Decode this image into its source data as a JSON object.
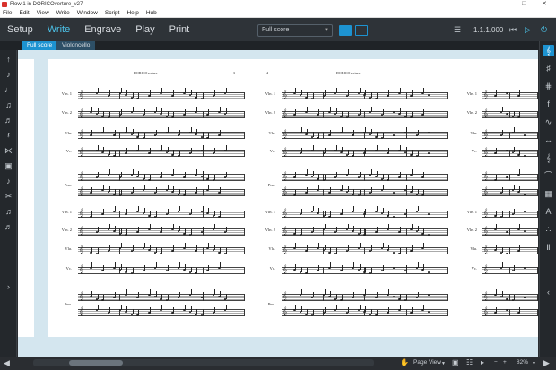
{
  "window": {
    "title": "Flow 1 in DORICOverture_v27",
    "controls": [
      "—",
      "□",
      "✕"
    ]
  },
  "menu": [
    "File",
    "Edit",
    "View",
    "Write",
    "Window",
    "Script",
    "Help",
    "Hub"
  ],
  "modes": [
    {
      "label": "Setup",
      "active": false
    },
    {
      "label": "Write",
      "active": true
    },
    {
      "label": "Engrave",
      "active": false
    },
    {
      "label": "Play",
      "active": false
    },
    {
      "label": "Print",
      "active": false
    }
  ],
  "toolbar": {
    "layout_select": "Full score",
    "rhythmic_position": "1.1.1.000"
  },
  "tabs": [
    "Full score",
    "Violoncello"
  ],
  "score": {
    "title": "DORICOverture",
    "page_numbers": [
      "3",
      "4"
    ],
    "instruments": [
      "Vln. 1",
      "Vln. 2",
      "Vla.",
      "Vc.",
      "Pno."
    ]
  },
  "status": {
    "view_mode": "Page View",
    "zoom": "82%"
  },
  "colors": {
    "accent": "#1d93d1",
    "mode_active": "#4cc2e8",
    "canvas_bg": "#d4e6ef"
  },
  "icons": {
    "left_panel": [
      "select-icon",
      "eighth-note-icon",
      "dotted-note-icon",
      "tie-icon",
      "chord-icon",
      "rest-icon",
      "slash-icon",
      "lock-icon",
      "grace-note-icon",
      "scissors-icon",
      "tuplet-icon",
      "triplet-icon"
    ],
    "right_panel": [
      "clef-icon",
      "key-sig-icon",
      "time-sig-icon",
      "dynamics-icon",
      "ornaments-icon",
      "articulation-icon",
      "repeat-icon",
      "arc-icon",
      "glissando-icon",
      "text-icon",
      "lyrics-icon",
      "fingering-icon"
    ]
  }
}
